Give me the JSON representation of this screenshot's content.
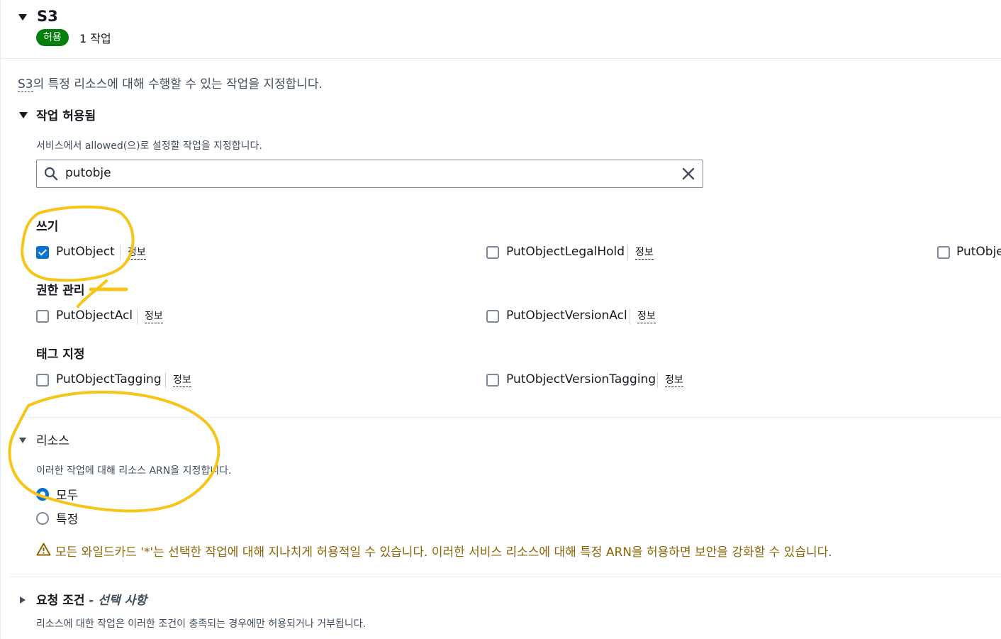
{
  "service": {
    "title": "S3",
    "badge": "허용",
    "count": "1 작업"
  },
  "description": {
    "prefix": "S3",
    "text": "의 특정 리소스에 대해 수행할 수 있는 작업을 지정합니다."
  },
  "actions_allowed": {
    "title": "작업 허용됨",
    "description": "서비스에서 allowed(으)로 설정할 작업을 지정합니다.",
    "search_value": "putobje"
  },
  "groups": {
    "write": {
      "label": "쓰기",
      "items": [
        {
          "label": "PutObject",
          "info": "정보",
          "checked": true
        },
        {
          "label": "PutObjectLegalHold",
          "info": "정보",
          "checked": false
        },
        {
          "label": "PutObje",
          "checked": false
        }
      ]
    },
    "permissions": {
      "label": "권한 관리",
      "items": [
        {
          "label": "PutObjectAcl",
          "info": "정보",
          "checked": false
        },
        {
          "label": "PutObjectVersionAcl",
          "info": "정보",
          "checked": false
        }
      ]
    },
    "tagging": {
      "label": "태그 지정",
      "items": [
        {
          "label": "PutObjectTagging",
          "info": "정보",
          "checked": false
        },
        {
          "label": "PutObjectVersionTagging",
          "info": "정보",
          "checked": false
        }
      ]
    }
  },
  "resources": {
    "title": "리소스",
    "description": "이러한 작업에 대해 리소스 ARN을 지정합니다.",
    "options": [
      {
        "label": "모두",
        "selected": true
      },
      {
        "label": "특정",
        "selected": false
      }
    ],
    "warning": "모든 와일드카드 '*'는 선택한 작업에 대해 지나치게 허용적일 수 있습니다. 이러한 서비스 리소스에 대해 특정 ARN을 허용하면 보안을 강화할 수 있습니다."
  },
  "conditions": {
    "title": "요청 조건",
    "optional": "- 선택 사항",
    "description": "리소스에 대한 작업은 이러한 조건이 충족되는 경우에만 허용되거나 거부됩니다."
  },
  "colors": {
    "badge": "#037f0c",
    "accent": "#0972d3",
    "warning": "#8d6605",
    "annotation": "#f5c518"
  },
  "icons": {
    "search": "search-icon",
    "clear": "close-icon",
    "warning": "warning-icon"
  }
}
